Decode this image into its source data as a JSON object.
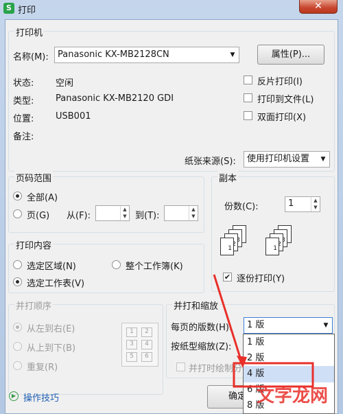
{
  "window": {
    "title": "打印",
    "app_icon": "S",
    "close_symbol": "✕"
  },
  "printer": {
    "group_title": "打印机",
    "name_label": "名称(M):",
    "name_value": "Panasonic KX-MB2128CN",
    "properties_button": "属性(P)...",
    "status_label": "状态:",
    "status_value": "空闲",
    "type_label": "类型:",
    "type_value": "Panasonic KX-MB2120 GDI",
    "location_label": "位置:",
    "location_value": "USB001",
    "comment_label": "备注:",
    "options": [
      {
        "label": "反片打印(I)",
        "checked": false
      },
      {
        "label": "打印到文件(L)",
        "checked": false
      },
      {
        "label": "双面打印(X)",
        "checked": false
      }
    ],
    "paper_source_label": "纸张来源(S):",
    "paper_source_value": "使用打印机设置"
  },
  "page_range": {
    "group_title": "页码范围",
    "all_label": "全部(A)",
    "pages_label": "页(G)",
    "from_label": "从(F):",
    "to_label": "到(T):",
    "from_value": "",
    "to_value": ""
  },
  "copies": {
    "group_title": "副本",
    "count_label": "份数(C):",
    "count_value": "1",
    "page_numbers": [
      "1",
      "2",
      "3"
    ],
    "collate_label": "逐份打印(Y)",
    "collate_checked": true
  },
  "print_content": {
    "group_title": "打印内容",
    "selection_label": "选定区域(N)",
    "workbook_label": "整个工作簿(K)",
    "sheet_label": "选定工作表(V)"
  },
  "print_order": {
    "group_title": "并打顺序",
    "ltr_label": "从左到右(E)",
    "ttb_label": "从上到下(B)",
    "repeat_label": "重复(R)",
    "grid": [
      "1",
      "2",
      "3",
      "4",
      "5",
      "6"
    ]
  },
  "scale": {
    "group_title": "并打和缩放",
    "pages_per_sheet_label": "每页的版数(H):",
    "pages_per_sheet_value": "1 版",
    "scale_label": "按纸型缩放(Z):",
    "draw_border_label": "并打时绘制分",
    "options": [
      "1 版",
      "2 版",
      "4 版",
      "6 版",
      "8 版"
    ],
    "highlighted_option": "4 版"
  },
  "footer": {
    "tips_label": "操作技巧",
    "ok_button": "确定"
  },
  "watermark": {
    "text": "文字龙网"
  },
  "colors": {
    "annotation_red": "#e8302a",
    "selection_blue": "#cfe0f6",
    "link_blue": "#1f5fb4"
  }
}
